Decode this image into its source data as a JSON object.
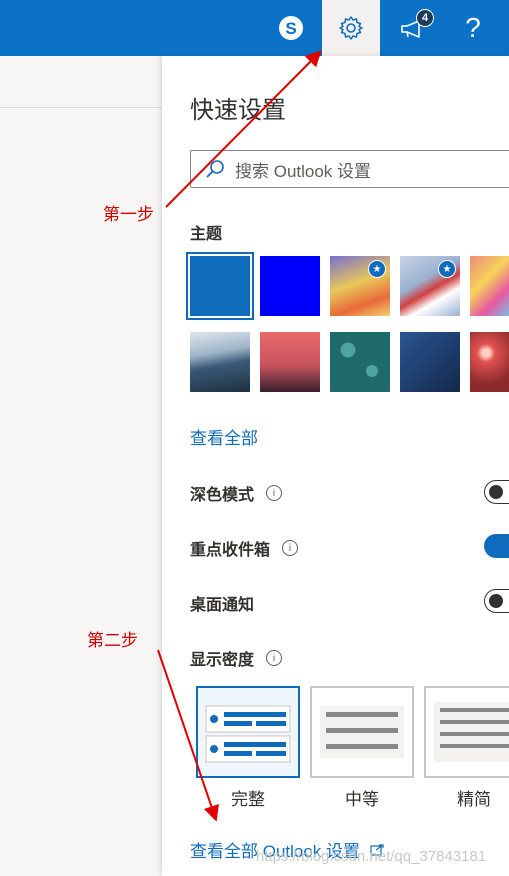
{
  "topbar": {
    "skype_icon": "skype-icon",
    "settings_icon": "gear-icon",
    "whatsnew_icon": "megaphone-icon",
    "whatsnew_badge": "4",
    "help_label": "?"
  },
  "panel": {
    "title": "快速设置",
    "search_placeholder": "搜索 Outlook 设置",
    "theme_heading": "主题",
    "view_all": "查看全部",
    "themes": [
      {
        "name": "blue",
        "color": "#0f6cbd",
        "selected": true
      },
      {
        "name": "bright-blue",
        "color": "#0000ff"
      },
      {
        "name": "sunrise",
        "color": "#e8c85a",
        "premium": true
      },
      {
        "name": "flag",
        "color": "#9ab0d0",
        "premium": true
      },
      {
        "name": "abstract",
        "color": "#f08a7a"
      },
      {
        "name": "mountain",
        "color": "#3a5a78"
      },
      {
        "name": "palms",
        "color": "#c9535f"
      },
      {
        "name": "circuit",
        "color": "#1f6b6b"
      },
      {
        "name": "elevation",
        "color": "#1f3f70"
      },
      {
        "name": "lights",
        "color": "#b43a3a"
      }
    ],
    "dark_mode": {
      "label": "深色模式",
      "on": false
    },
    "focused_inbox": {
      "label": "重点收件箱",
      "on": true
    },
    "desktop_notifications": {
      "label": "桌面通知",
      "on": false
    },
    "density_heading": "显示密度",
    "density_options": [
      {
        "label": "完整",
        "selected": true
      },
      {
        "label": "中等",
        "selected": false
      },
      {
        "label": "精简",
        "selected": false
      }
    ],
    "view_all_settings": "查看全部 Outlook 设置",
    "info_icon": "info-icon"
  },
  "annotations": {
    "step1": "第一步",
    "step2": "第二步",
    "color": "#d00000"
  },
  "watermark": "https://blog.csdn.net/qq_37843181"
}
